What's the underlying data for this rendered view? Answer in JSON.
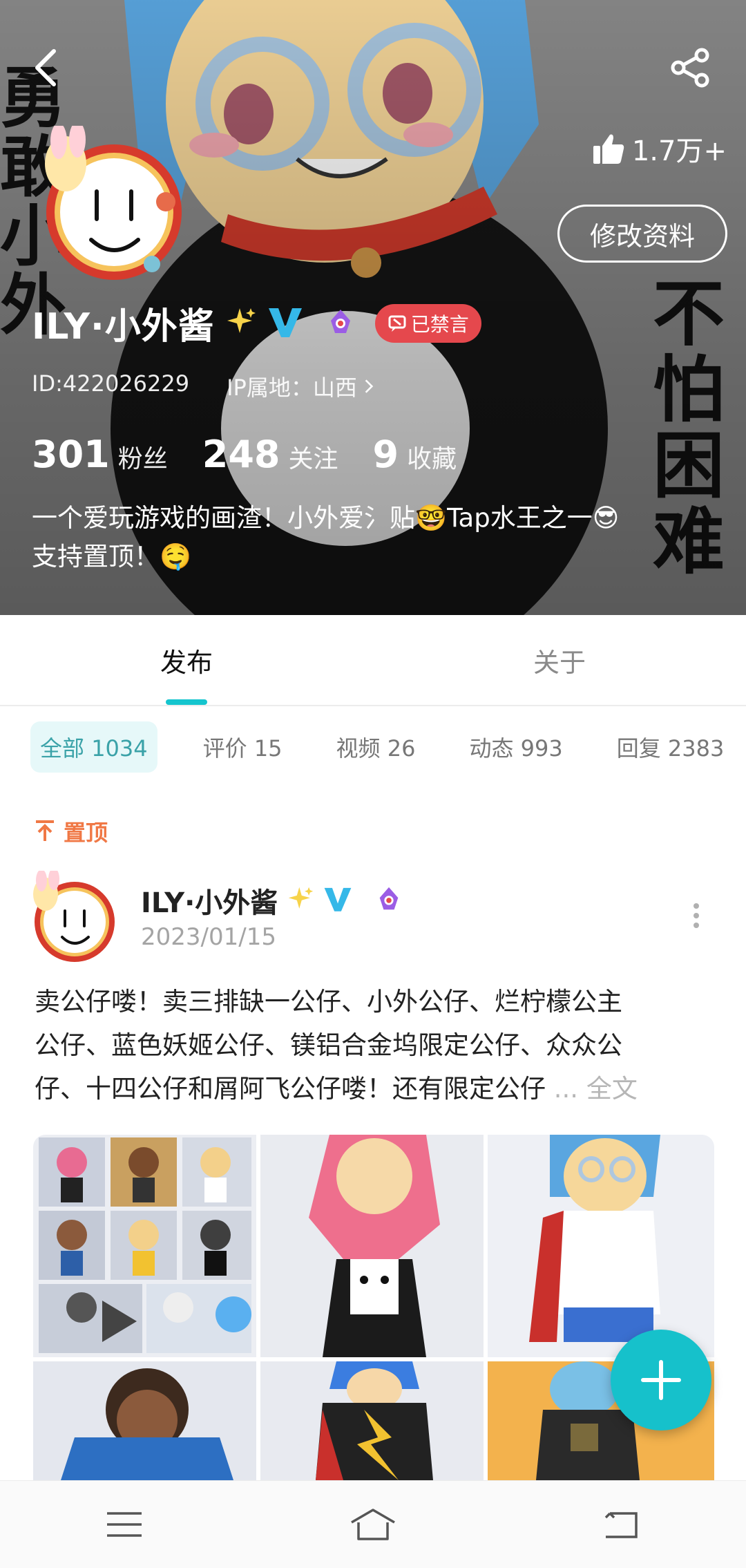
{
  "header": {
    "likes": "1.7万+",
    "edit_profile_label": "修改资料",
    "cover_text_left": "勇敢小外",
    "cover_text_right": "不怕困难"
  },
  "profile": {
    "name": "ILY·小外酱",
    "muted_badge": "已禁言",
    "id_text": "ID:422026229",
    "ip_location": "IP属地：山西",
    "stats": [
      {
        "value": "301",
        "label": "粉丝"
      },
      {
        "value": "248",
        "label": "关注"
      },
      {
        "value": "9",
        "label": "收藏"
      }
    ],
    "bio_line1": "一个爱玩游戏的画渣！小外爱氵贴🤓Tap水王之一😎",
    "bio_line2": "支持置顶！🤤"
  },
  "tabs": [
    {
      "label": "发布",
      "active": true
    },
    {
      "label": "关于",
      "active": false
    }
  ],
  "filters": [
    {
      "label": "全部",
      "count": "1034",
      "active": true
    },
    {
      "label": "评价",
      "count": "15",
      "active": false
    },
    {
      "label": "视频",
      "count": "26",
      "active": false
    },
    {
      "label": "动态",
      "count": "993",
      "active": false
    },
    {
      "label": "回复",
      "count": "2383",
      "active": false
    }
  ],
  "pinned_label": "置顶",
  "post": {
    "author": "ILY·小外酱",
    "date": "2023/01/15",
    "text_line1": "卖公仔喽！卖三排缺一公仔、小外公仔、烂柠檬公主",
    "text_line2": "公仔、蓝色妖姬公仔、镁铝合金坞限定公仔、众众公",
    "text_line3": "仔、十四公仔和屑阿飞公仔喽！还有限定公仔",
    "ellipsis": "...",
    "more_label": "全文"
  },
  "colors": {
    "accent": "#15c5ce",
    "muted_badge": "#e5484d",
    "pin": "#f07845",
    "verified": "#35b8e8"
  },
  "icons": [
    "back-arrow-icon",
    "share-icon",
    "thumb-up-icon",
    "sparkle-icon",
    "verified-v-icon",
    "level-crest-icon",
    "mute-icon",
    "chevron-right-icon",
    "pin-arrow-icon",
    "more-vertical-icon",
    "plus-icon",
    "menu-icon",
    "home-icon",
    "back-nav-icon"
  ]
}
